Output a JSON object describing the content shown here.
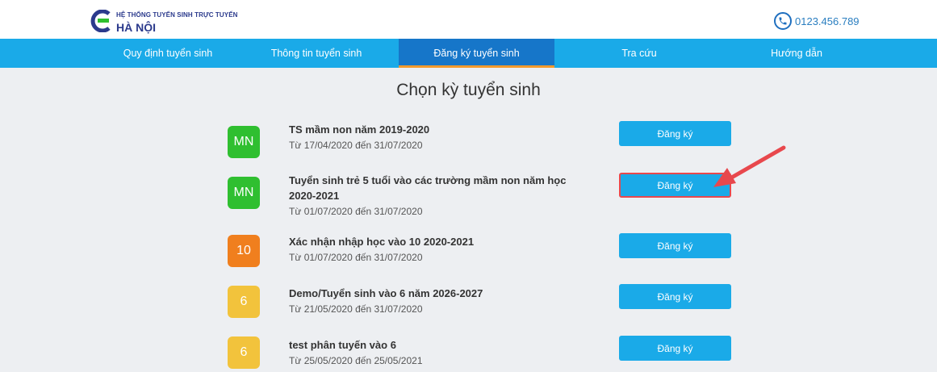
{
  "header": {
    "logo_line1": "HỆ THỐNG TUYỂN SINH TRỰC TUYẾN",
    "logo_line2": "HÀ NỘI",
    "phone": "0123.456.789"
  },
  "nav": {
    "items": [
      {
        "label": "Quy định tuyển sinh"
      },
      {
        "label": "Thông tin tuyển sinh"
      },
      {
        "label": "Đăng ký tuyển sinh"
      },
      {
        "label": "Tra cứu"
      },
      {
        "label": "Hướng dẫn"
      }
    ],
    "active": "Đăng ký tuyển sinh"
  },
  "page": {
    "title": "Chọn kỳ tuyển sinh"
  },
  "colors": {
    "green": "#2fbf30",
    "orange": "#f07f1e",
    "yellow": "#f2c33c",
    "button": "#1aaae8",
    "arrow": "#e8484d"
  },
  "rows": [
    {
      "badge": "MN",
      "name": "TS mầm non năm 2019-2020",
      "date": "Từ 17/04/2020 đến 31/07/2020",
      "button": "Đăng ký"
    },
    {
      "badge": "MN",
      "name": "Tuyển sinh trẻ 5 tuổi vào các trường mầm non năm học 2020-2021",
      "date": "Từ 01/07/2020 đến 31/07/2020",
      "button": "Đăng ký"
    },
    {
      "badge": "10",
      "name": "Xác nhận nhập học vào 10 2020-2021",
      "date": "Từ 01/07/2020 đến 31/07/2020",
      "button": "Đăng ký"
    },
    {
      "badge": "6",
      "name": "Demo/Tuyển sinh vào 6 năm 2026-2027",
      "date": "Từ 21/05/2020 đến 31/07/2020",
      "button": "Đăng ký"
    },
    {
      "badge": "6",
      "name": "test phân tuyến vào 6",
      "date": "Từ 25/05/2020 đến 25/05/2021",
      "button": "Đăng ký"
    }
  ]
}
